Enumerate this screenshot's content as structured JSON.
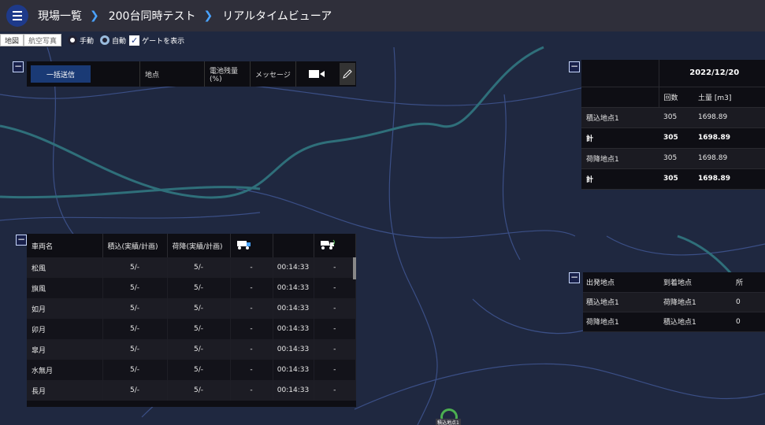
{
  "breadcrumbs": [
    "現場一覧",
    "200台同時テスト",
    "リアルタイムビューア"
  ],
  "map": {
    "types": [
      "地図",
      "航空写真"
    ],
    "mode_manual": "手動",
    "mode_auto": "自動",
    "gate_label": "ゲートを表示"
  },
  "toolbar": {
    "send_label": "一括送信",
    "location_label": "地点",
    "battery_label": "電池残量(%)",
    "message_label": "メッセージ"
  },
  "summary": {
    "date": "2022/12/20",
    "col_count": "回数",
    "col_volume": "土量 [m3]",
    "rows": [
      {
        "name": "積込地点1",
        "count": "305",
        "volume": "1698.89",
        "bold": false
      },
      {
        "name": "計",
        "count": "305",
        "volume": "1698.89",
        "bold": true
      },
      {
        "name": "荷降地点1",
        "count": "305",
        "volume": "1698.89",
        "bold": false
      },
      {
        "name": "計",
        "count": "305",
        "volume": "1698.89",
        "bold": true
      }
    ]
  },
  "vehicles": {
    "headers": [
      "車両名",
      "積込(実績/計画)",
      "荷降(実績/計画)"
    ],
    "rows": [
      {
        "name": "松風",
        "load": "5/-",
        "unload": "5/-",
        "c4": "-",
        "time": "00:14:33",
        "c6": "-"
      },
      {
        "name": "旗風",
        "load": "5/-",
        "unload": "5/-",
        "c4": "-",
        "time": "00:14:33",
        "c6": "-"
      },
      {
        "name": "如月",
        "load": "5/-",
        "unload": "5/-",
        "c4": "-",
        "time": "00:14:33",
        "c6": "-"
      },
      {
        "name": "卯月",
        "load": "5/-",
        "unload": "5/-",
        "c4": "-",
        "time": "00:14:33",
        "c6": "-"
      },
      {
        "name": "皐月",
        "load": "5/-",
        "unload": "5/-",
        "c4": "-",
        "time": "00:14:33",
        "c6": "-"
      },
      {
        "name": "水無月",
        "load": "5/-",
        "unload": "5/-",
        "c4": "-",
        "time": "00:14:33",
        "c6": "-"
      },
      {
        "name": "長月",
        "load": "5/-",
        "unload": "5/-",
        "c4": "-",
        "time": "00:14:33",
        "c6": "-"
      }
    ]
  },
  "route": {
    "headers": [
      "出発地点",
      "到着地点",
      "所"
    ],
    "rows": [
      {
        "from": "積込地点1",
        "to": "荷降地点1",
        "extra": "0"
      },
      {
        "from": "荷降地点1",
        "to": "積込地点1",
        "extra": "0"
      }
    ]
  },
  "pin_label": "積込地点1",
  "colors": {
    "map_bg": "#1f2840",
    "road": "#2f6f7a",
    "accent": "#1a3a75"
  }
}
